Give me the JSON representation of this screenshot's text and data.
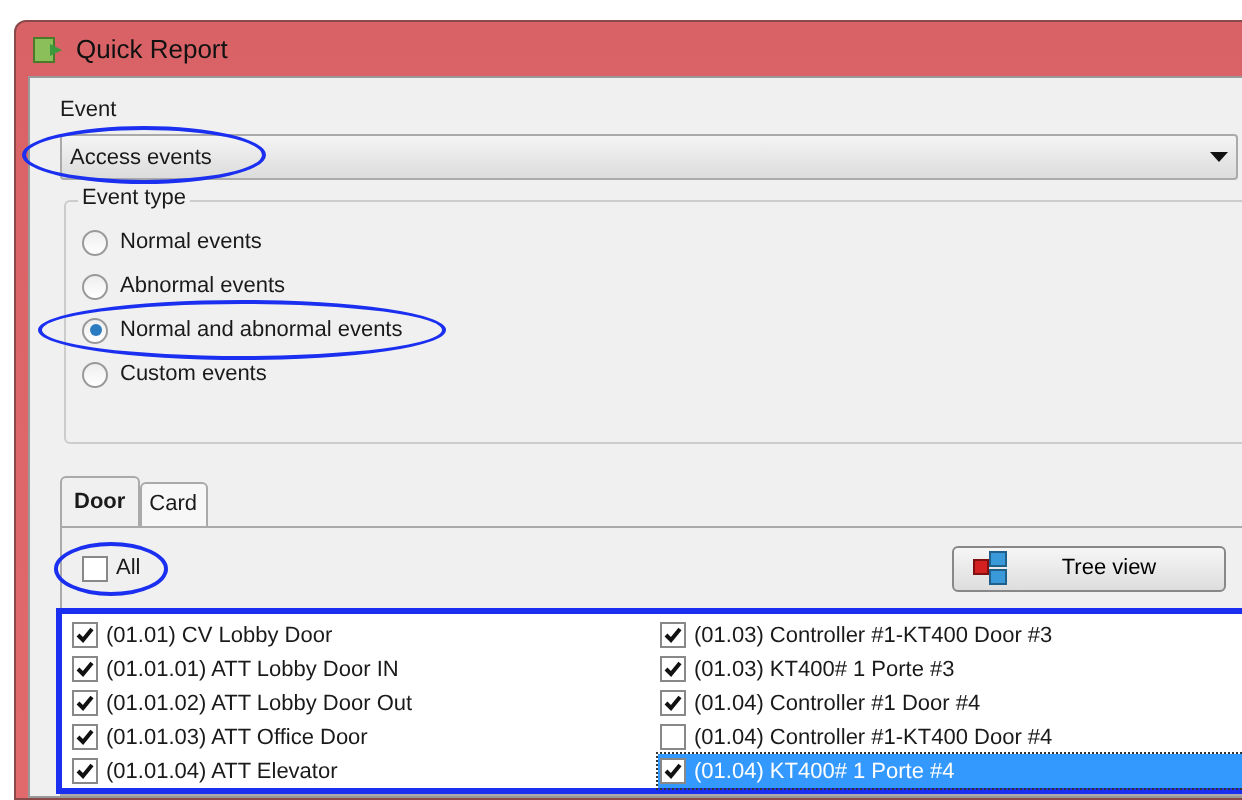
{
  "window": {
    "title": "Quick Report"
  },
  "event": {
    "label": "Event",
    "value": "Access events",
    "highlighted": true
  },
  "event_type": {
    "label": "Event type",
    "options": [
      {
        "label": "Normal events",
        "selected": false,
        "highlighted": false
      },
      {
        "label": "Abnormal events",
        "selected": false,
        "highlighted": false
      },
      {
        "label": "Normal and abnormal events",
        "selected": true,
        "highlighted": true
      },
      {
        "label": "Custom events",
        "selected": false,
        "highlighted": false
      }
    ]
  },
  "tabs": [
    {
      "label": "Door",
      "selected": true
    },
    {
      "label": "Card",
      "selected": false
    }
  ],
  "all_checkbox": {
    "label": "All",
    "checked": false,
    "highlighted": true
  },
  "tree_view_button": {
    "label": "Tree view"
  },
  "door_list": {
    "highlighted": true,
    "columns": [
      [
        {
          "label": "(01.01) CV Lobby Door",
          "checked": true,
          "selected": false
        },
        {
          "label": "(01.01.01) ATT Lobby Door IN",
          "checked": true,
          "selected": false
        },
        {
          "label": "(01.01.02) ATT Lobby Door Out",
          "checked": true,
          "selected": false
        },
        {
          "label": "(01.01.03) ATT Office Door",
          "checked": true,
          "selected": false
        },
        {
          "label": "(01.01.04) ATT Elevator",
          "checked": true,
          "selected": false
        }
      ],
      [
        {
          "label": "(01.03) Controller #1-KT400 Door #3",
          "checked": true,
          "selected": false
        },
        {
          "label": "(01.03) KT400# 1 Porte #3",
          "checked": true,
          "selected": false
        },
        {
          "label": "(01.04) Controller #1 Door #4",
          "checked": true,
          "selected": false
        },
        {
          "label": "(01.04) Controller #1-KT400 Door #4",
          "checked": false,
          "selected": false
        },
        {
          "label": "(01.04) KT400# 1 Porte #4",
          "checked": true,
          "selected": true
        }
      ]
    ]
  }
}
